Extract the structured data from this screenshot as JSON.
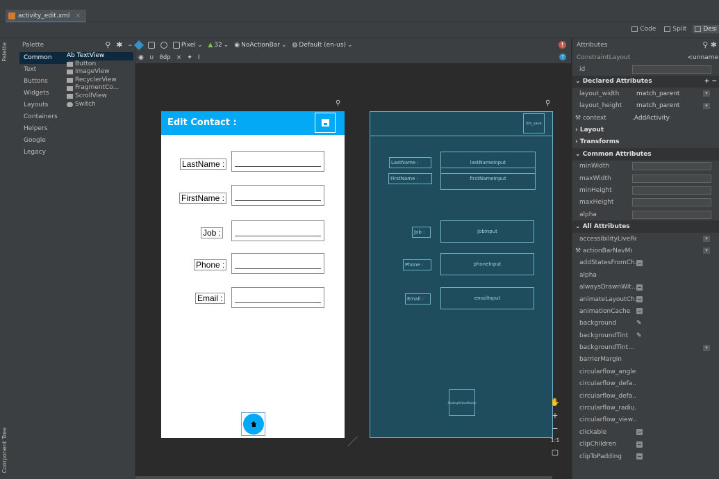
{
  "file_tab": {
    "name": "activity_edit.xml",
    "close": "×"
  },
  "mode_bar": {
    "code": "Code",
    "split": "Split",
    "design": "Desi"
  },
  "side_strip": {
    "palette": "Palette",
    "component_tree": "Component Tree"
  },
  "palette": {
    "title": "Palette",
    "categories": [
      "Common",
      "Text",
      "Buttons",
      "Widgets",
      "Layouts",
      "Containers",
      "Helpers",
      "Google",
      "Legacy"
    ],
    "selected_category": "Common",
    "items": [
      "Ab TextView",
      "Button",
      "ImageView",
      "RecyclerView",
      "FragmentCo...",
      "ScrollView",
      "Switch"
    ]
  },
  "design_toolbar": {
    "device": "Pixel",
    "api": "32",
    "theme": "NoActionBar",
    "locale": "Default (en-us)",
    "margin": "0dp"
  },
  "phone": {
    "title": "Edit Contact :",
    "fields": [
      {
        "label": "LastName :"
      },
      {
        "label": "FirstName :"
      },
      {
        "label": "Job :"
      },
      {
        "label": "Phone :"
      },
      {
        "label": "Email :"
      }
    ]
  },
  "blueprint": {
    "appbar_btn": "btn_save",
    "labels": [
      "LastName :",
      "FirstName :",
      "Job :",
      "Phone :",
      "Email :"
    ],
    "inputs": [
      "lastNameInput",
      "firstNameInput",
      "jobInput",
      "phoneInput",
      "emailInput"
    ],
    "fab": "floatingActionButton"
  },
  "zoom": {
    "reset": "1:1"
  },
  "attributes": {
    "title": "Attributes",
    "component": "ConstraintLayout",
    "component_name": "<unname",
    "id_label": "id",
    "declared_section": "Declared Attributes",
    "declared": [
      {
        "name": "layout_width",
        "value": "match_parent"
      },
      {
        "name": "layout_height",
        "value": "match_parent"
      },
      {
        "name": "context",
        "value": ".AddActivity"
      }
    ],
    "layout_section": "Layout",
    "transforms_section": "Transforms",
    "common_section": "Common Attributes",
    "common": [
      "minWidth",
      "maxWidth",
      "minHeight",
      "maxHeight",
      "alpha"
    ],
    "all_section": "All Attributes",
    "all": [
      "accessibilityLiveRe...",
      "actionBarNavMode",
      "addStatesFromCh...",
      "alpha",
      "alwaysDrawnWit...",
      "animateLayoutCh...",
      "animationCache",
      "background",
      "backgroundTint",
      "backgroundTint...",
      "barrierMargin",
      "circularflow_angles",
      "circularflow_defa...",
      "circularflow_defa...",
      "circularflow_radiu...",
      "circularflow_view...",
      "clickable",
      "clipChildren",
      "clipToPadding"
    ]
  }
}
